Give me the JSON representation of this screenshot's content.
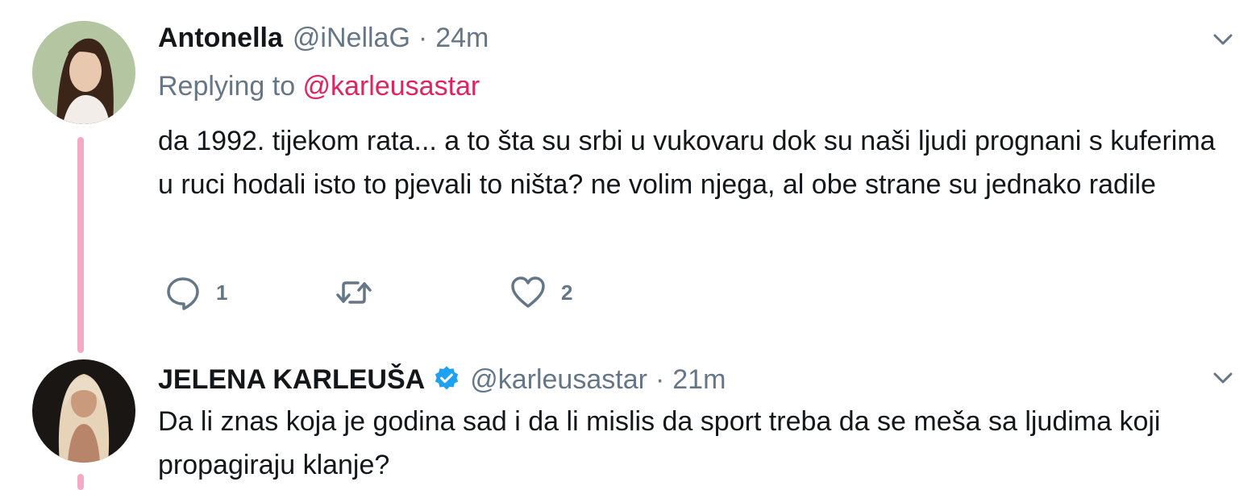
{
  "tweet1": {
    "name": "Antonella",
    "handle": "@iNellaG",
    "separator": "·",
    "time": "24m",
    "replying_prefix": "Replying to ",
    "replying_to": "@karleusastar",
    "text": "da 1992. tijekom rata... a to šta su srbi u vukovaru dok su naši ljudi prognani s kuferima u ruci hodali isto to pjevali to ništa? ne volim njega, al obe strane su jednako radile",
    "reply_count": "1",
    "like_count": "2",
    "accent_color": "#e0245e",
    "thread_color": "#f4a9c5"
  },
  "tweet2": {
    "name": "JELENA KARLEUŠA",
    "verified": true,
    "handle": "@karleusastar",
    "separator": "·",
    "time": "21m",
    "text": "Da li znas koja je godina sad i da li mislis da sport treba da se meša sa ljudima koji propagiraju klanje?"
  },
  "icons": {
    "reply": "reply-icon",
    "retweet": "retweet-icon",
    "like": "heart-icon",
    "more": "chevron-down-icon",
    "verified": "verified-badge-icon"
  }
}
